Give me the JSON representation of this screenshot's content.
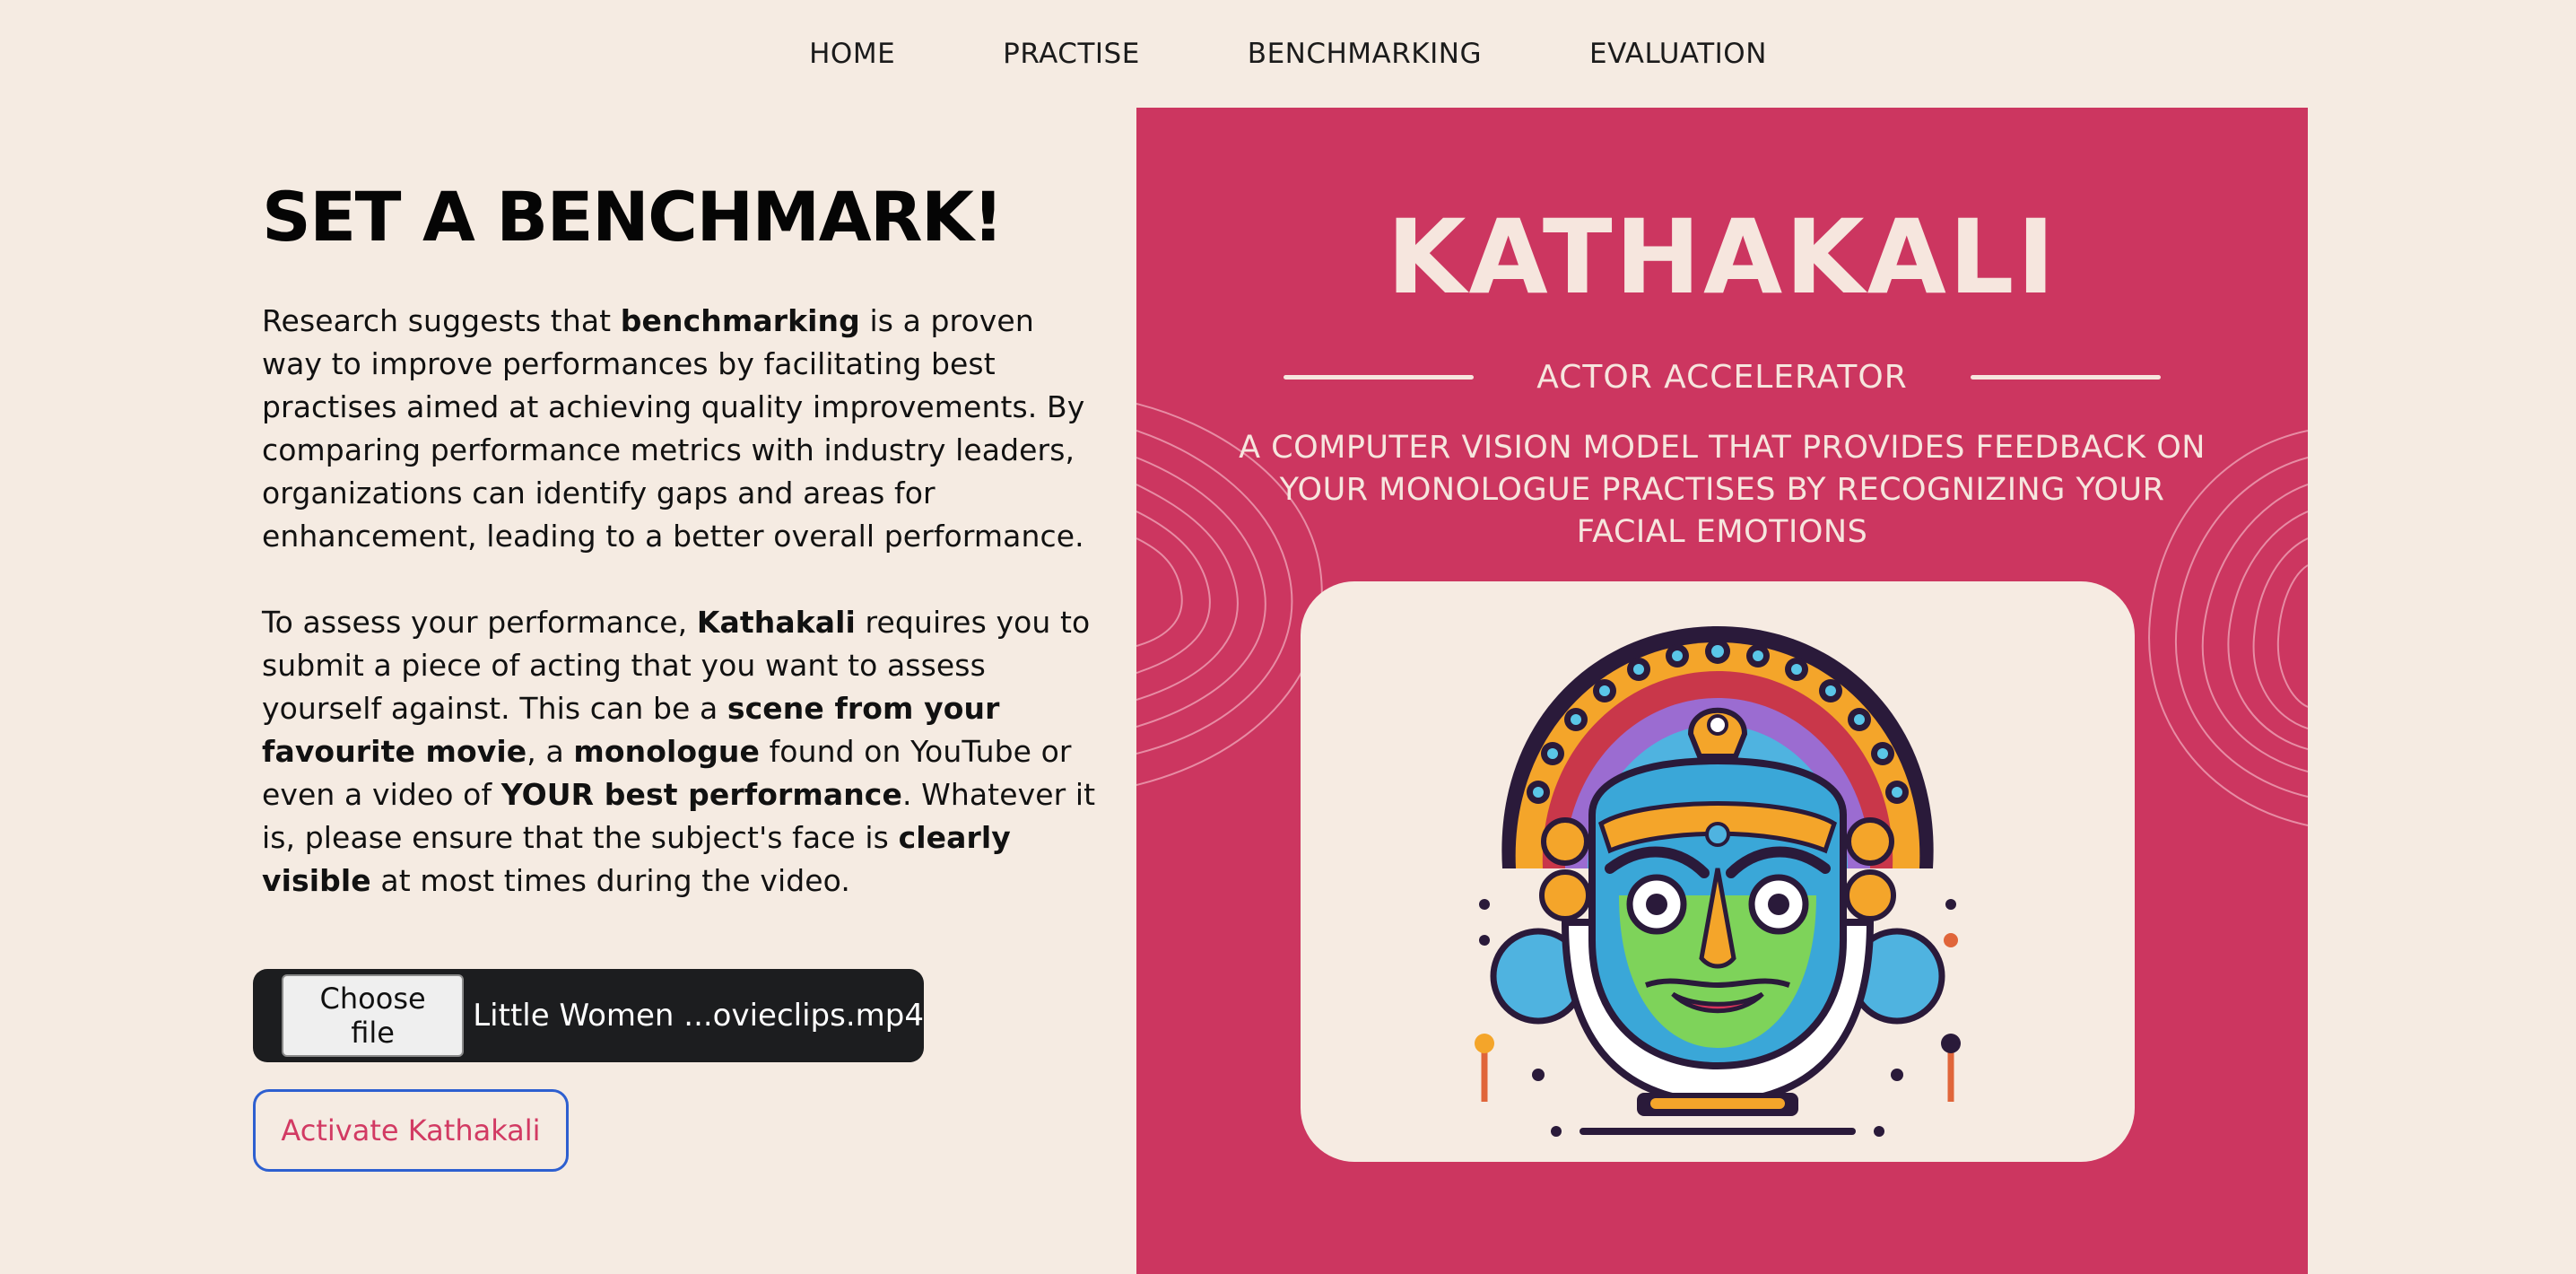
{
  "nav": {
    "items": [
      "HOME",
      "PRACTISE",
      "BENCHMARKING",
      "EVALUATION"
    ]
  },
  "main": {
    "heading": "SET A BENCHMARK!",
    "para1": [
      {
        "t": "Research suggests that ",
        "b": false
      },
      {
        "t": "benchmarking",
        "b": true
      },
      {
        "t": " is a proven way to improve performances by facilitating best practises aimed at achieving quality improvements. By comparing performance metrics with industry leaders, organizations can identify gaps and areas for enhancement, leading to a better overall performance.",
        "b": false
      }
    ],
    "para2": [
      {
        "t": "To assess your performance, ",
        "b": false
      },
      {
        "t": "Kathakali",
        "b": true
      },
      {
        "t": " requires you to submit a piece of acting that you want to assess yourself against. This can be a ",
        "b": false
      },
      {
        "t": "scene from your favourite movie",
        "b": true
      },
      {
        "t": ", a ",
        "b": false
      },
      {
        "t": "monologue",
        "b": true
      },
      {
        "t": " found on YouTube or even a video of ",
        "b": false
      },
      {
        "t": "YOUR best performance",
        "b": true
      },
      {
        "t": ". Whatever it is, please ensure that the subject's face is ",
        "b": false
      },
      {
        "t": "clearly visible",
        "b": true
      },
      {
        "t": " at most times during the video.",
        "b": false
      }
    ]
  },
  "upload": {
    "button_label": "Choose file",
    "file_name": "Little Women ...ovieclips.mp4"
  },
  "activate_label": "Activate Kathakali",
  "panel": {
    "brand": "KATHAKALI",
    "tag": "ACTOR  ACCELERATOR",
    "tagline": "A COMPUTER VISION MODEL THAT PROVIDES FEEDBACK ON YOUR MONOLOGUE PRACTISES BY RECOGNIZING YOUR FACIAL EMOTIONS"
  },
  "colors": {
    "page_bg": "#f5ebe2",
    "panel_bg": "#cc3660",
    "accent_text": "#d23a63",
    "button_border": "#2d5fd0",
    "upload_bg": "#1c1d1f"
  }
}
